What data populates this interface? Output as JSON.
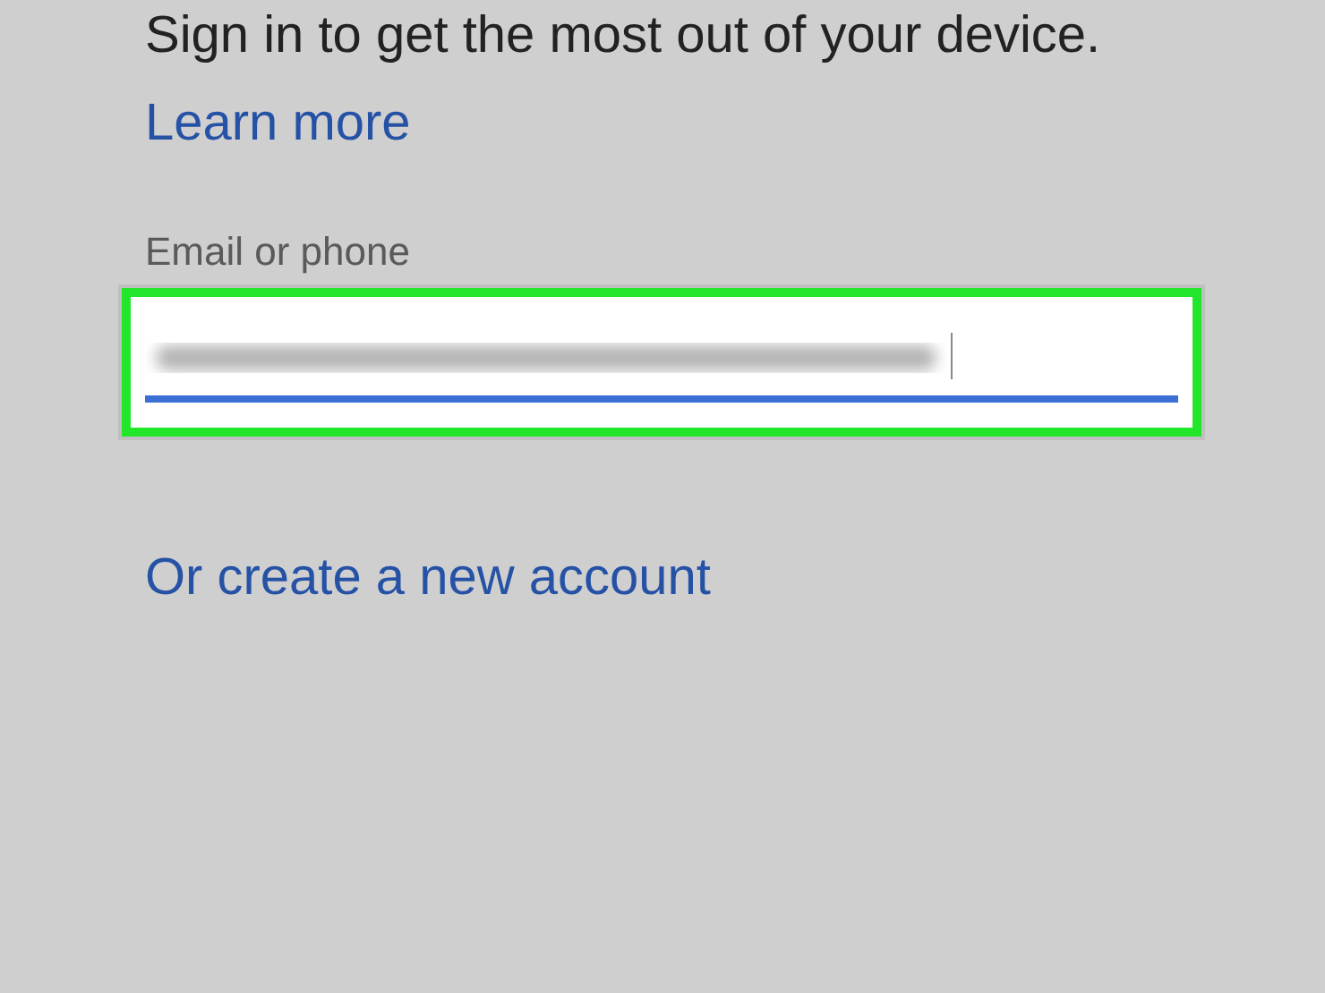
{
  "intro": {
    "text": "Sign in to get the most out of your device.",
    "link": "Learn more"
  },
  "email_field": {
    "label": "Email or phone",
    "focused": true,
    "highlighted": true
  },
  "create_account_link": "Or create a new account"
}
